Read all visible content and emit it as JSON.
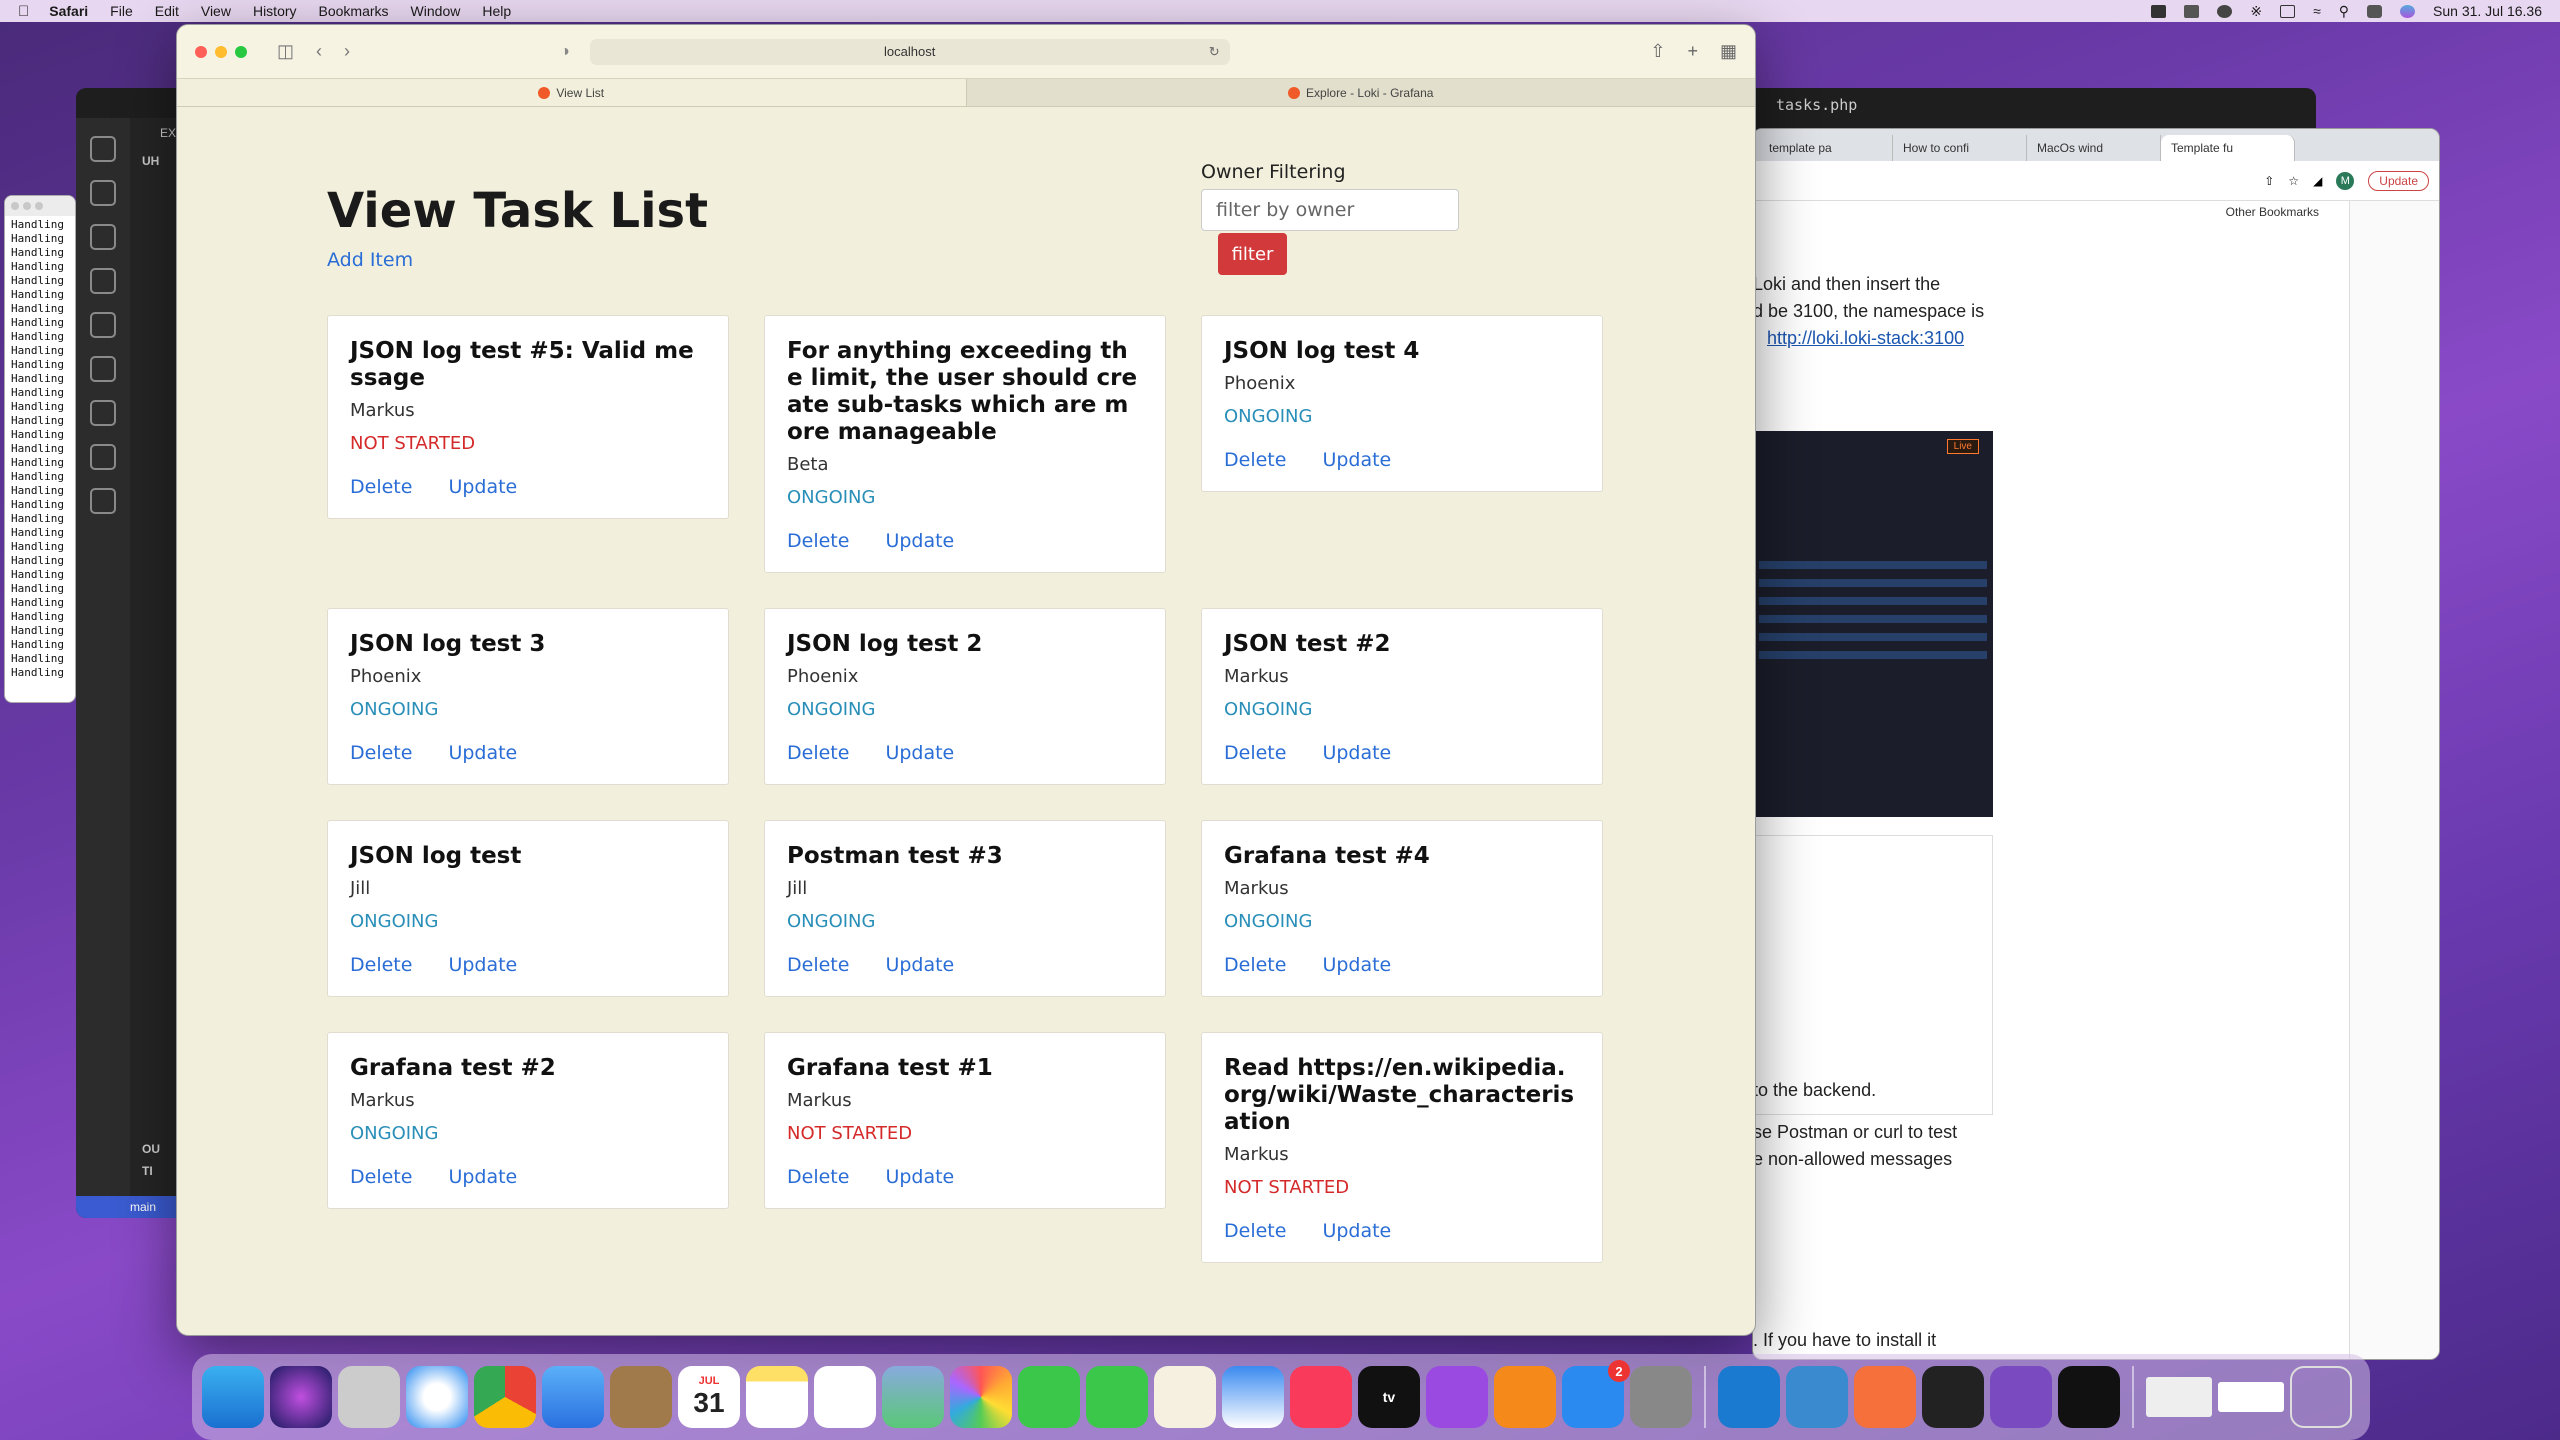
{
  "menubar": {
    "app": "Safari",
    "items": [
      "File",
      "Edit",
      "View",
      "History",
      "Bookmarks",
      "Window",
      "Help"
    ],
    "clock": "Sun 31. Jul  16.36"
  },
  "terminal_mini": {
    "line": "Handling"
  },
  "vscode": {
    "editor_tab": "tasks.php",
    "explorer_header": "EX",
    "folder": "UH",
    "outline": "OU",
    "timeline": "TI",
    "branch": "main"
  },
  "chrome": {
    "tabs": [
      "template pa",
      "How to confi",
      "MacOs wind",
      "Template fu"
    ],
    "update_label": "Update",
    "avatar": "M",
    "bookmarks": "Other Bookmarks",
    "article": {
      "p1": "Loki and then insert the",
      "p2": "d be 3100, the namespace is",
      "link": "http://loki.loki-stack:3100",
      "p4": "to the backend.",
      "p5": "se Postman or curl to test",
      "p6": "e non-allowed messages",
      "p7": ". If you have to install it",
      "live": "Live"
    }
  },
  "safari": {
    "address": "localhost",
    "tabs": [
      {
        "label": "View List",
        "active": true
      },
      {
        "label": "Explore - Loki - Grafana",
        "active": false
      }
    ]
  },
  "page": {
    "title": "View Task List",
    "add_item": "Add Item",
    "filter_label": "Owner Filtering",
    "filter_placeholder": "filter by owner",
    "filter_button": "filter",
    "delete_label": "Delete",
    "update_label": "Update"
  },
  "tasks": [
    {
      "title": "JSON log test #5: Valid message",
      "owner": "Markus",
      "status": "NOT STARTED"
    },
    {
      "title": "For anything exceeding the limit, the user should create sub-tasks which are more manageable",
      "owner": "Beta",
      "status": "ONGOING"
    },
    {
      "title": "JSON log test 4",
      "owner": "Phoenix",
      "status": "ONGOING"
    },
    {
      "title": "JSON log test 3",
      "owner": "Phoenix",
      "status": "ONGOING"
    },
    {
      "title": "JSON log test 2",
      "owner": "Phoenix",
      "status": "ONGOING"
    },
    {
      "title": "JSON test #2",
      "owner": "Markus",
      "status": "ONGOING"
    },
    {
      "title": "JSON log test",
      "owner": "Jill",
      "status": "ONGOING"
    },
    {
      "title": "Postman test #3",
      "owner": "Jill",
      "status": "ONGOING"
    },
    {
      "title": "Grafana test #4",
      "owner": "Markus",
      "status": "ONGOING"
    },
    {
      "title": "Grafana test #2",
      "owner": "Markus",
      "status": "ONGOING"
    },
    {
      "title": "Grafana test #1",
      "owner": "Markus",
      "status": "NOT STARTED"
    },
    {
      "title": "Read https://en.wikipedia.org/wiki/Waste_characterisation",
      "owner": "Markus",
      "status": "NOT STARTED"
    }
  ],
  "dock": {
    "calendar_month": "JUL",
    "calendar_day": "31",
    "tv_label": "tv",
    "appstore_badge": "2"
  },
  "colors": {
    "ongoing": "#2a8fb8",
    "not_started": "#d42a2a",
    "link": "#2a6dd6",
    "filter_button": "#d1393b",
    "page_bg": "#f2f0dc"
  }
}
